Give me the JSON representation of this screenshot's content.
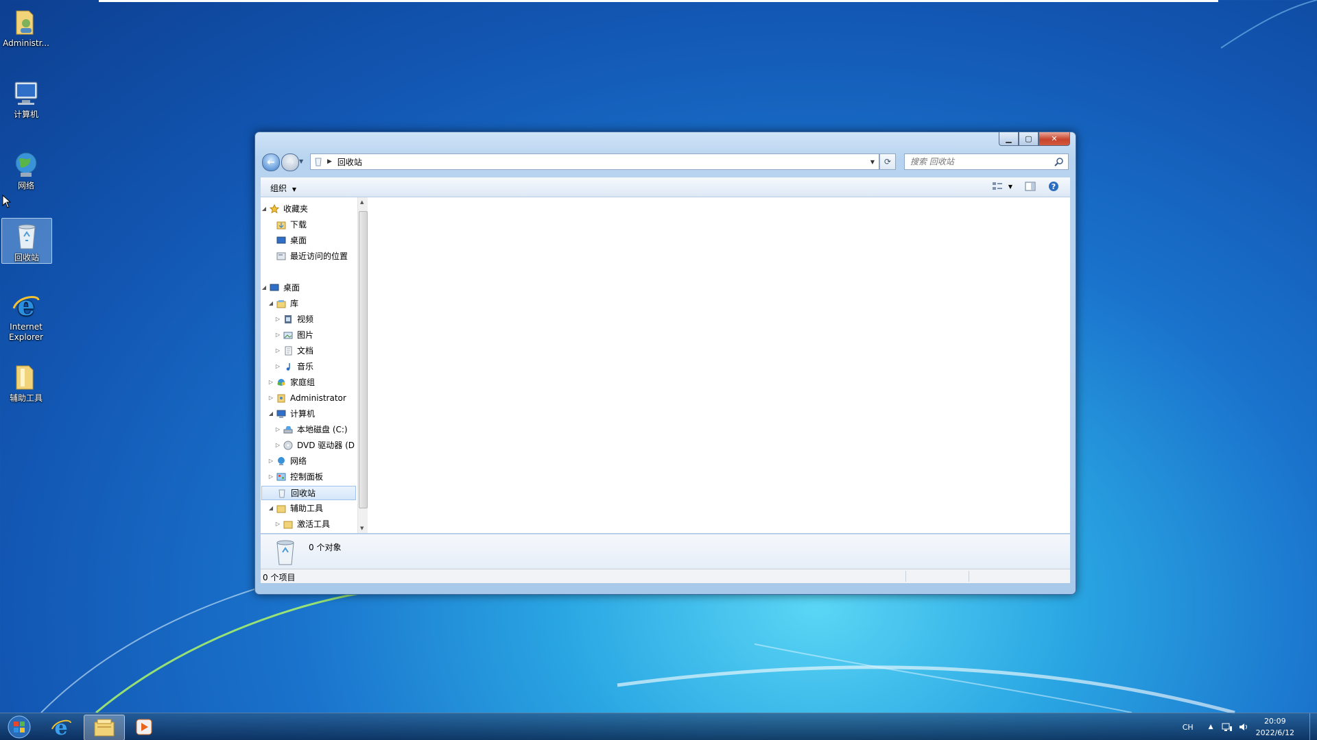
{
  "desktop": {
    "icons": [
      {
        "label": "Administr..."
      },
      {
        "label": "计算机"
      },
      {
        "label": "网络"
      },
      {
        "label": "回收站"
      },
      {
        "label": "Internet\nExplorer"
      },
      {
        "label": "辅助工具"
      }
    ]
  },
  "window": {
    "address": "回收站",
    "search_placeholder": "搜索 回收站",
    "toolbar": {
      "organize": "组织"
    },
    "tree": [
      {
        "label": "收藏夹"
      },
      {
        "label": "下载"
      },
      {
        "label": "桌面"
      },
      {
        "label": "最近访问的位置"
      },
      {
        "label": "桌面"
      },
      {
        "label": "库"
      },
      {
        "label": "视频"
      },
      {
        "label": "图片"
      },
      {
        "label": "文档"
      },
      {
        "label": "音乐"
      },
      {
        "label": "家庭组"
      },
      {
        "label": "Administrator"
      },
      {
        "label": "计算机"
      },
      {
        "label": "本地磁盘 (C:)"
      },
      {
        "label": "DVD 驱动器 (D"
      },
      {
        "label": "网络"
      },
      {
        "label": "控制面板"
      },
      {
        "label": "回收站"
      },
      {
        "label": "辅助工具"
      },
      {
        "label": "激活工具"
      }
    ],
    "details_text": "0 个对象",
    "status_text": "0 个项目"
  },
  "taskbar": {
    "language": "CH",
    "time": "20:09",
    "date": "2022/6/12"
  }
}
